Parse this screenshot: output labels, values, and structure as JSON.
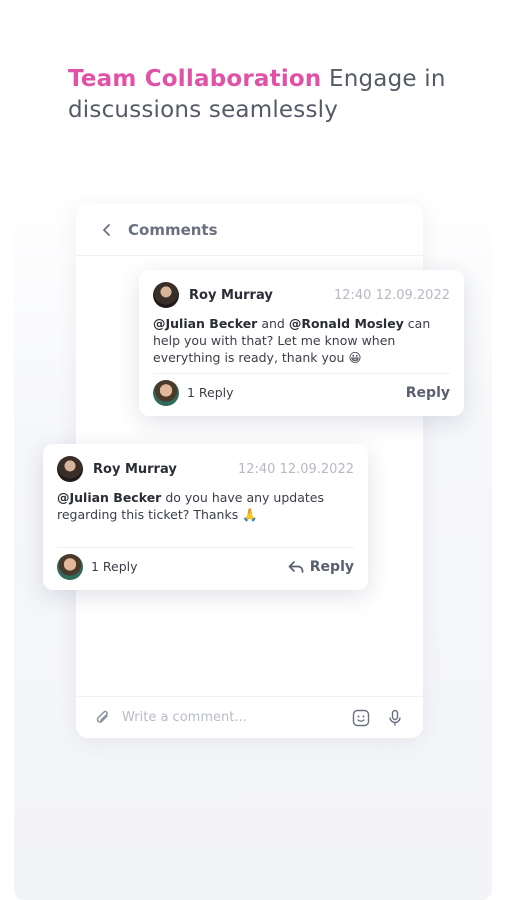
{
  "headline": {
    "accent": "Team Collaboration",
    "rest": " Engage in discussions seamlessly"
  },
  "panel": {
    "title": "Comments",
    "composer_placeholder": "Write a comment..."
  },
  "comments": [
    {
      "author": "Roy Murray",
      "timestamp": "12:40 12.09.2022",
      "mention1": "@Julian Becker",
      "text1": " and ",
      "mention2": "@Ronald Mosley",
      "text2": " can help you with that? Let me know when everything is ready, thank you 😀",
      "reply_count": "1 Reply",
      "reply_label": "Reply"
    },
    {
      "author": "Roy Murray",
      "timestamp": "12:40 12.09.2022",
      "mention1": "@Julian Becker",
      "text1": " do you have any updates regarding this ticket? Thanks 🙏",
      "reply_count": "1 Reply",
      "reply_label": "Reply"
    }
  ],
  "icons": {
    "back": "chevron-left-icon",
    "attach": "paperclip-icon",
    "emoji": "emoji-icon",
    "mic": "microphone-icon",
    "reply": "reply-arrow-icon"
  },
  "colors": {
    "accent": "#e052a8",
    "text": "#555a66",
    "muted": "#b5b9c3"
  }
}
